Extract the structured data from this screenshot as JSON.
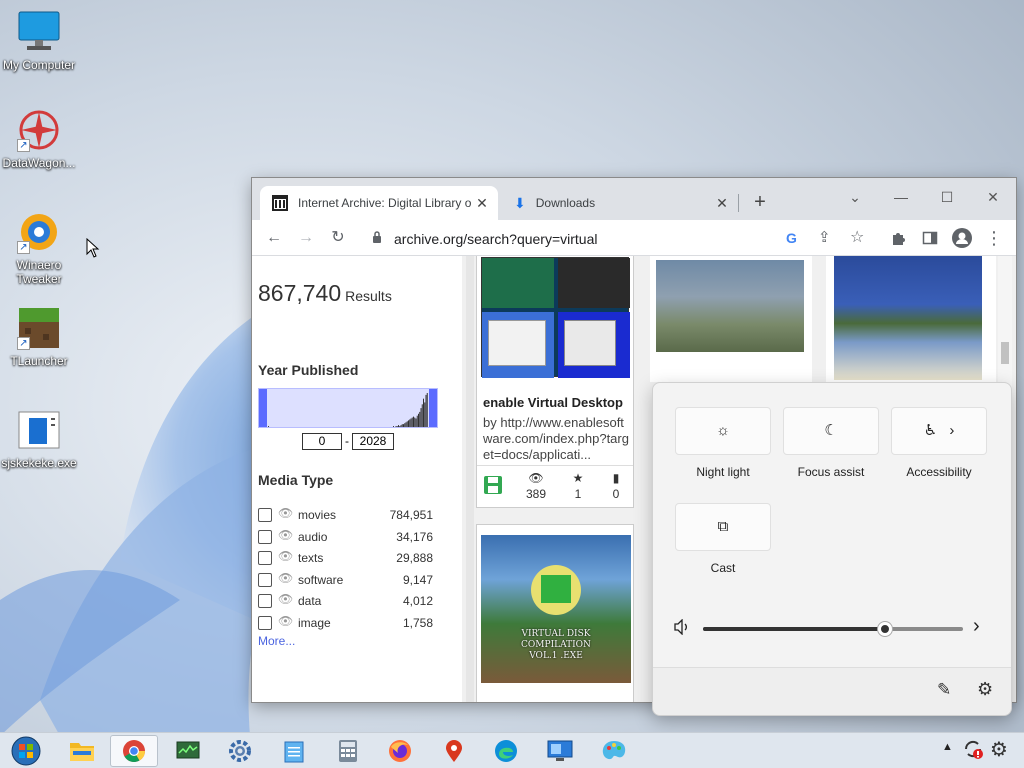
{
  "desktop": {
    "icons": [
      {
        "label": "My Computer"
      },
      {
        "label": "DataWagon..."
      },
      {
        "label": "Winaero Tweaker"
      },
      {
        "label": "TLauncher"
      },
      {
        "label": "sjskekeke.exe"
      }
    ]
  },
  "browser": {
    "tabs": [
      {
        "title": "Internet Archive: Digital Library o",
        "close": "✕"
      },
      {
        "title": "Downloads",
        "close": "✕"
      }
    ],
    "new_tab": "+",
    "url": "archive.org/search?query=virtual",
    "window_controls": {
      "minimize": "—",
      "maximize": "☐",
      "close": "✕",
      "tab_search": "⌄"
    },
    "toolbar_icons": {
      "back": "←",
      "forward": "→",
      "reload": "↻",
      "bookmark": "☆",
      "menu": "⋮"
    }
  },
  "page": {
    "results": {
      "count": "867,740",
      "label": "Results"
    },
    "year_published": {
      "title": "Year Published",
      "min": "0",
      "max": "2028",
      "separator": "-",
      "histogram": [
        1,
        0,
        0,
        0,
        0,
        0,
        0,
        0,
        0,
        0,
        0,
        0,
        0,
        0,
        0,
        0,
        0,
        0,
        0,
        0,
        0,
        0,
        0,
        0,
        0,
        0,
        0,
        0,
        0,
        0,
        0,
        0,
        0,
        0,
        0,
        0,
        0,
        0,
        0,
        0,
        0,
        0,
        0,
        0,
        0,
        0,
        0,
        0,
        0,
        0,
        0,
        0,
        0,
        0,
        0,
        0,
        0,
        0,
        0,
        0,
        0,
        0,
        0,
        0,
        0,
        0,
        0,
        0,
        0,
        0,
        0,
        0,
        0,
        0,
        0,
        0,
        0,
        0,
        0,
        0,
        0,
        0,
        0,
        0,
        0,
        0,
        0,
        0,
        0,
        0,
        0,
        0,
        0,
        0,
        0,
        0,
        0,
        0,
        0,
        0,
        1,
        0,
        1,
        1,
        2,
        1,
        2,
        3,
        3,
        4,
        5,
        6,
        7,
        8,
        9,
        10,
        11,
        10,
        9,
        12,
        14,
        16,
        20,
        24,
        30,
        26,
        34,
        36
      ]
    },
    "media_type": {
      "title": "Media Type",
      "items": [
        {
          "name": "movies",
          "count": "784,951"
        },
        {
          "name": "audio",
          "count": "34,176"
        },
        {
          "name": "texts",
          "count": "29,888"
        },
        {
          "name": "software",
          "count": "9,147"
        },
        {
          "name": "data",
          "count": "4,012"
        },
        {
          "name": "image",
          "count": "1,758"
        }
      ],
      "more": "More..."
    },
    "cards": [
      {
        "title": "enable Virtual Desktop",
        "description": "by http://www.enablesoftware.com/index.php?target=docs/applicati...",
        "views": "389",
        "favorites": "1",
        "reviews": "0"
      },
      {
        "thumb_text_1": "VIRTUAL DISK",
        "thumb_text_2": "COMPILATION",
        "thumb_text_3": "VOL.1 .EXE"
      }
    ]
  },
  "quick_settings": {
    "tiles": [
      {
        "label": "Night light",
        "icon": "☼"
      },
      {
        "label": "Focus assist",
        "icon": "☾"
      },
      {
        "label": "Accessibility",
        "icon": "♿",
        "chevron": "›"
      },
      {
        "label": "Cast",
        "icon": "⧉"
      }
    ],
    "volume": {
      "level": 0.7,
      "icon": "🔈",
      "chevron": "›"
    },
    "footer": {
      "edit_icon": "✎",
      "settings_icon": "⚙"
    }
  },
  "taskbar": {
    "items": [
      "start",
      "file-explorer",
      "chrome",
      "task-manager",
      "settings",
      "notepad",
      "calculator",
      "firefox",
      "maps",
      "edge",
      "remote-desktop",
      "paint"
    ]
  },
  "colors": {
    "slider_handle": "#5b6bff",
    "slider_fill": "#dde0ff",
    "link": "#4b64e0",
    "save_icon": "#32a852"
  }
}
